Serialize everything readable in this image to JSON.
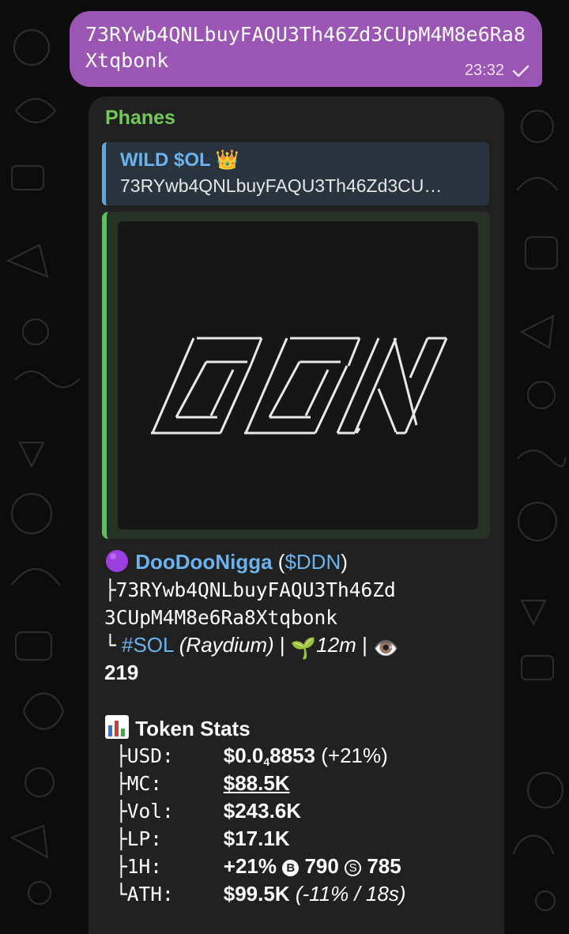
{
  "outgoing": {
    "text": "73RYwb4QNLbuyFAQU3Th46Zd3CUpM4M8e6Ra8Xtqbonk",
    "time": "23:32",
    "status_icon": "single-check-icon"
  },
  "incoming": {
    "sender": "Phanes",
    "reply": {
      "title": "WILD $OL 👑",
      "text": "73RYwb4QNLbuyFAQU3Th46Zd3CU…"
    },
    "media": {
      "ascii_art": [
        "    ______  ______  __   __",
        "   / ___  \\/ ___  \\/ /  / /",
        "  / /  / // /  / /   \\/ /",
        " / /__/ // /__/ / /\\  /",
        "/______/ \\_____/_/ \\_/"
      ],
      "logo_text": "DDN"
    },
    "token": {
      "dot_icon": "purple-circle-icon",
      "name": "DooDooNigga",
      "ticker_open": " (",
      "ticker": "$DDN",
      "ticker_close": ")",
      "tree_top": "├",
      "address_line1": "73RYwb4QNLbuyFAQU3Th46Zd",
      "address_line2": "3CUpM4M8e6Ra8Xtqbonk",
      "tree_bottom": "└",
      "chain": "#SOL",
      "dex": "(Raydium)",
      "sep1": " | ",
      "seedling": "🌱",
      "age": "12m",
      "sep2": " | ",
      "eye": "👁️",
      "views": "219"
    },
    "stats": {
      "icon": "📊",
      "title": "Token Stats",
      "rows": [
        {
          "branch": "├",
          "key": "USD:",
          "value_main": "$0.0",
          "value_sub": "4",
          "value_rest": "8853",
          "extra": " (+21%)"
        },
        {
          "branch": "├",
          "key": "MC:",
          "value": "$88.5K"
        },
        {
          "branch": "├",
          "key": "Vol:",
          "value": "$243.6K"
        },
        {
          "branch": "├",
          "key": "LP:",
          "value": "$17.1K"
        },
        {
          "branch": "├",
          "key": "1H:",
          "value": "+21%",
          "buys_icon": "B",
          "buys": "790",
          "sells_icon": "S",
          "sells": "785"
        },
        {
          "branch": "└",
          "key": "ATH:",
          "value": "$99.5K",
          "extra": "(-11% / 18s)"
        }
      ]
    }
  }
}
